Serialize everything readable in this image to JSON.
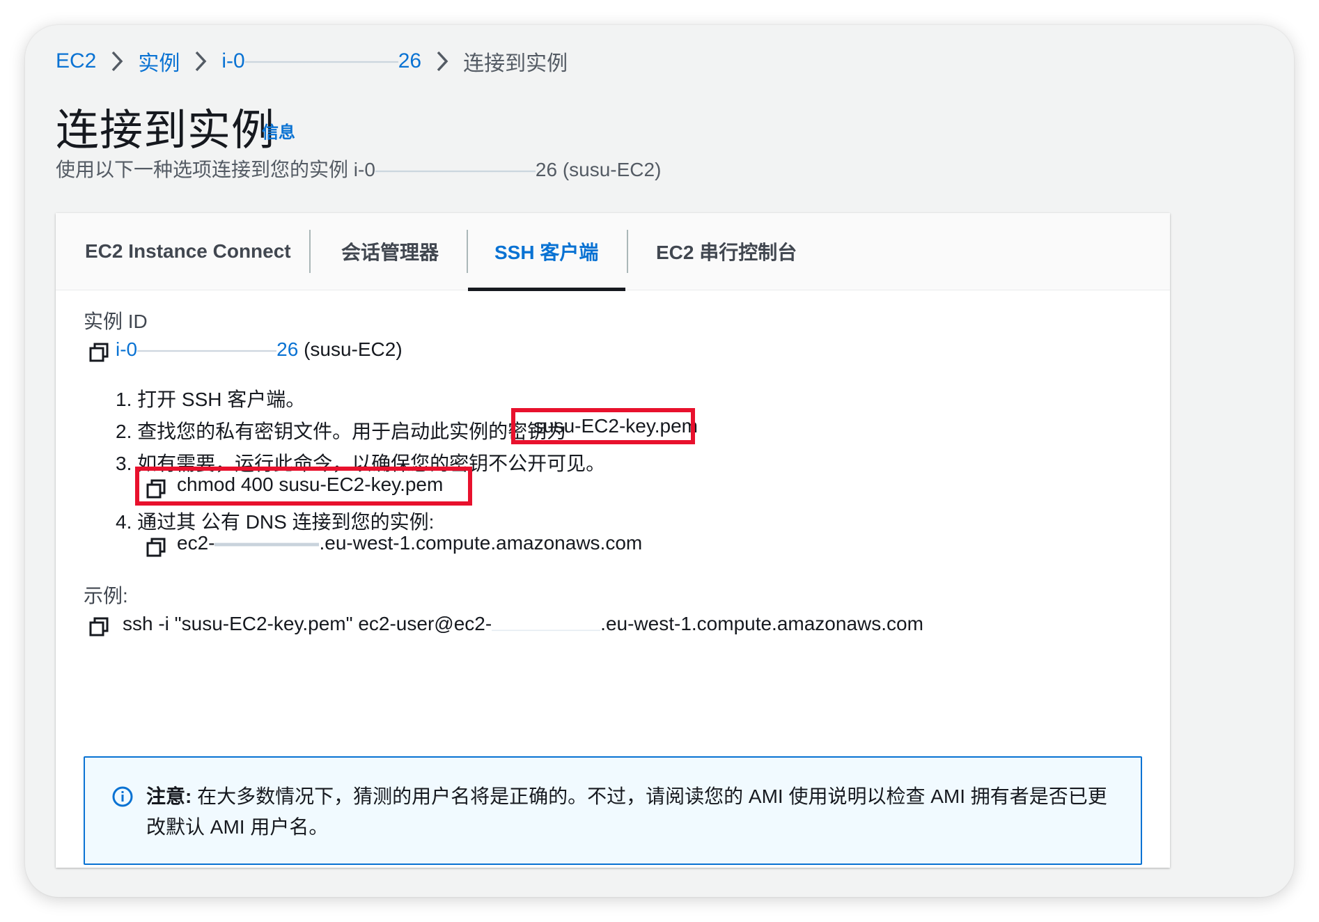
{
  "breadcrumb": {
    "ec2": "EC2",
    "instances": "实例",
    "instance_prefix": "i-0",
    "instance_suffix": "26",
    "current": "连接到实例"
  },
  "page": {
    "title": "连接到实例",
    "info": "信息",
    "subtitle_prefix": "使用以下一种选项连接到您的实例 i-0",
    "subtitle_suffix": "26 (susu-EC2)"
  },
  "tabs": [
    {
      "label": "EC2 Instance Connect",
      "active": false
    },
    {
      "label": "会话管理器",
      "active": false
    },
    {
      "label": "SSH 客户端",
      "active": true
    },
    {
      "label": "EC2 串行控制台",
      "active": false
    }
  ],
  "instance": {
    "label": "实例 ID",
    "id_prefix": "i-0",
    "id_suffix": "26",
    "name": "(susu-EC2)"
  },
  "steps": {
    "s1": "1. 打开 SSH 客户端。",
    "s2": "2. 查找您的私有密钥文件。用于启动此实例的密钥为",
    "s2_key": "susu-EC2-key.pem",
    "s3": "3. 如有需要，运行此命令，以确保您的密钥不公开可见。",
    "s3_cmd": "chmod 400 susu-EC2-key.pem",
    "s4": "4. 通过其 公有 DNS 连接到您的实例:",
    "s4_dns_prefix": "ec2-",
    "s4_dns_suffix": ".eu-west-1.compute.amazonaws.com"
  },
  "example": {
    "label": "示例:",
    "cmd_prefix": "ssh -i \"susu-EC2-key.pem\" ec2-user@ec2-",
    "cmd_suffix": ".eu-west-1.compute.amazonaws.com"
  },
  "note": {
    "strong": "注意:",
    "text": " 在大多数情况下，猜测的用户名将是正确的。不过，请阅读您的 AMI 使用说明以检查 AMI 拥有者是否已更改默认 AMI 用户名。"
  },
  "colors": {
    "link": "#0972d3",
    "highlight": "#e8112d",
    "note_bg": "#f1faff"
  }
}
